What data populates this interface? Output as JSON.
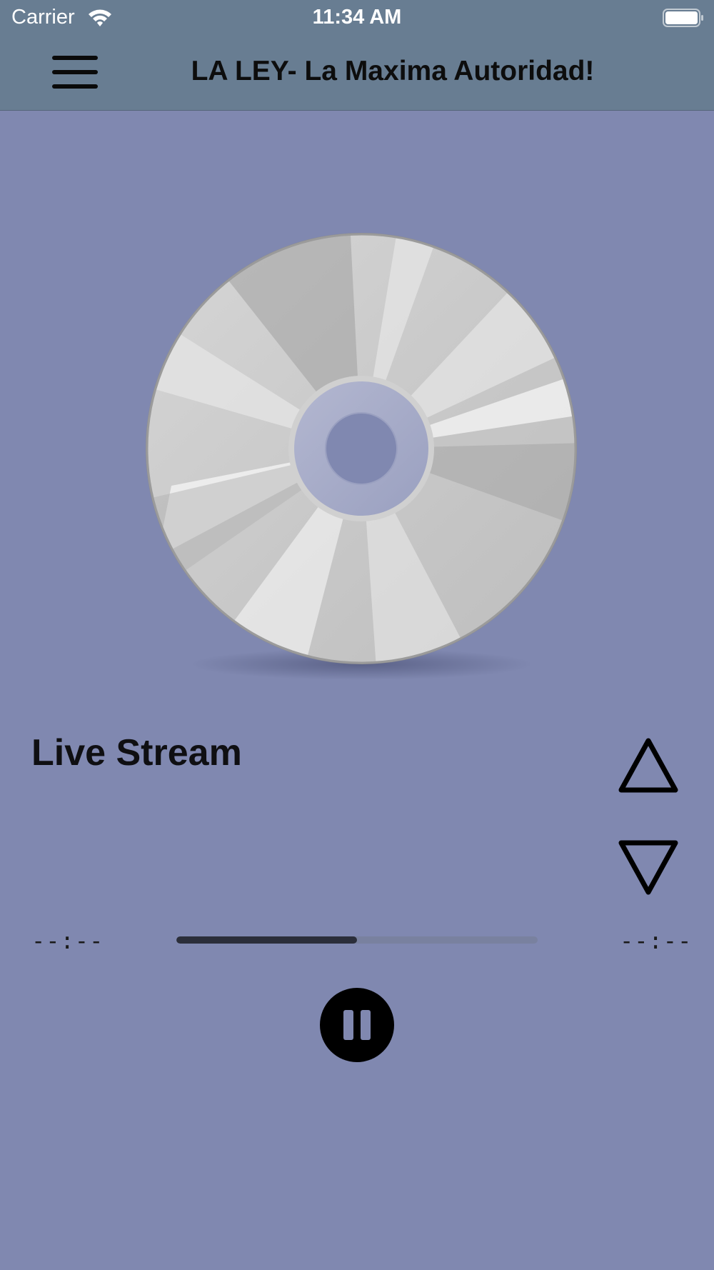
{
  "status_bar": {
    "carrier": "Carrier",
    "time": "11:34 AM",
    "icons": [
      "wifi-icon",
      "battery-icon"
    ]
  },
  "nav": {
    "title": "LA LEY- La Maxima Autoridad!",
    "menu_icon": "hamburger-menu-icon"
  },
  "player": {
    "artwork": "cd-disc-icon",
    "track_title": "Live Stream",
    "elapsed": "--:--",
    "remaining": "--:--",
    "progress": 0.5,
    "volume_up_icon": "triangle-up-icon",
    "volume_down_icon": "triangle-down-icon",
    "play_state_icon": "pause-icon"
  },
  "colors": {
    "background": "#8088b0",
    "top_bar": "#687d92",
    "progress_fill": "#2b2e3a"
  }
}
